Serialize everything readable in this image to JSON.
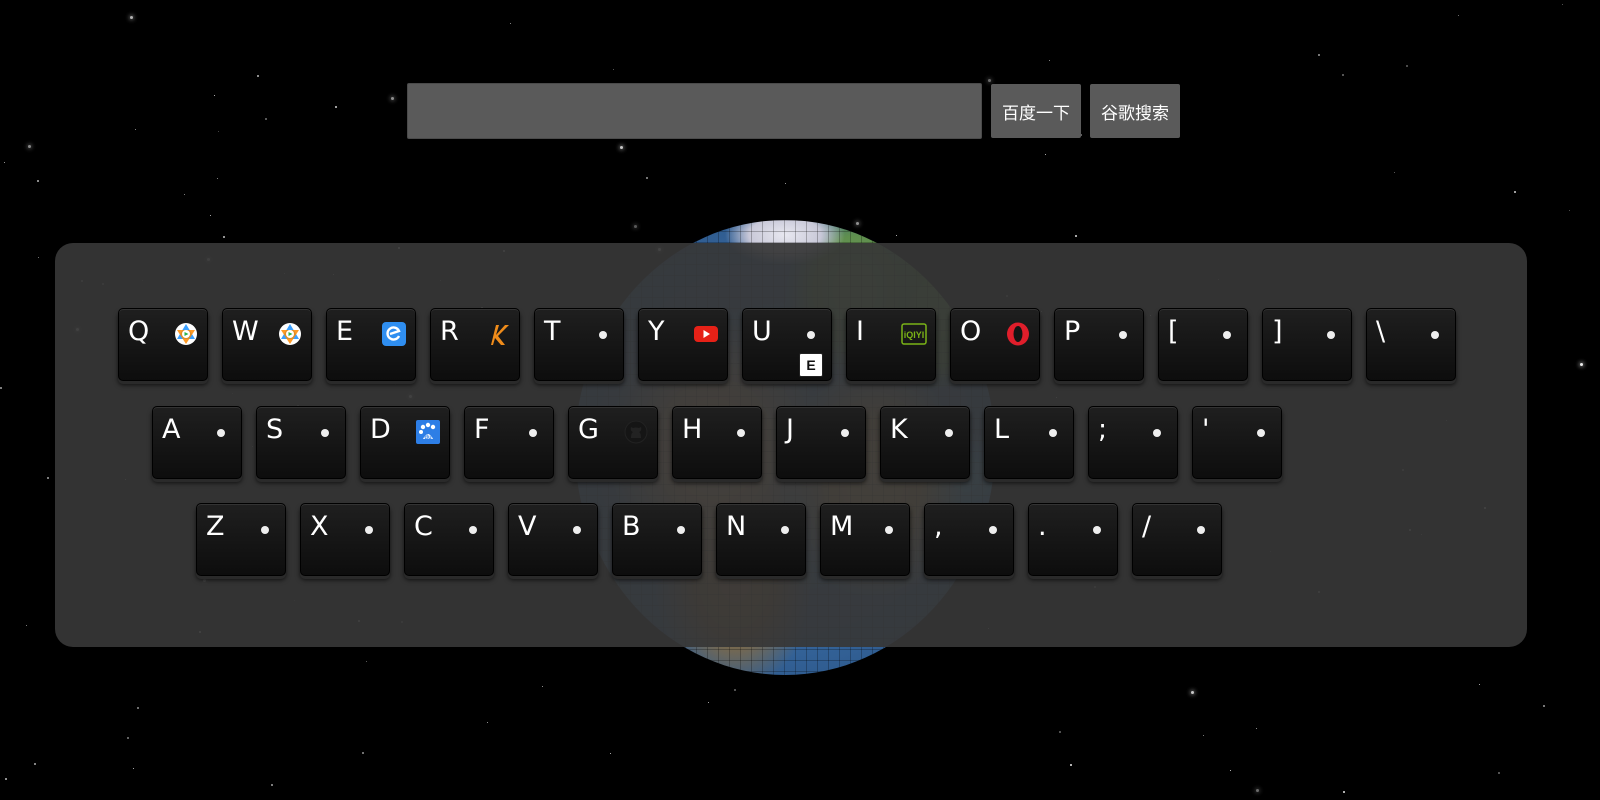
{
  "search": {
    "placeholder": "",
    "value": "",
    "baidu_label": "百度一下",
    "google_label": "谷歌搜索"
  },
  "keyboard": {
    "rows": [
      [
        {
          "key": "Q",
          "icon": "tencent-video-icon"
        },
        {
          "key": "W",
          "icon": "tencent-video-icon"
        },
        {
          "key": "E",
          "icon": "blue-e-icon"
        },
        {
          "key": "R",
          "icon": "orange-k-icon"
        },
        {
          "key": "T",
          "icon": "dot"
        },
        {
          "key": "Y",
          "icon": "youtube-icon"
        },
        {
          "key": "U",
          "icon": "dot",
          "badge": "E"
        },
        {
          "key": "I",
          "icon": "iqiyi-icon"
        },
        {
          "key": "O",
          "icon": "opera-icon"
        },
        {
          "key": "P",
          "icon": "dot"
        },
        {
          "key": "[",
          "icon": "dot"
        },
        {
          "key": "]",
          "icon": "dot"
        },
        {
          "key": "\\",
          "icon": "dot"
        }
      ],
      [
        {
          "key": "A",
          "icon": "dot"
        },
        {
          "key": "S",
          "icon": "dot"
        },
        {
          "key": "D",
          "icon": "baidu-icon"
        },
        {
          "key": "F",
          "icon": "dot"
        },
        {
          "key": "G",
          "icon": "github-icon"
        },
        {
          "key": "H",
          "icon": "dot"
        },
        {
          "key": "J",
          "icon": "dot"
        },
        {
          "key": "K",
          "icon": "dot"
        },
        {
          "key": "L",
          "icon": "dot"
        },
        {
          "key": ";",
          "icon": "dot"
        },
        {
          "key": "'",
          "icon": "dot"
        }
      ],
      [
        {
          "key": "Z",
          "icon": "dot"
        },
        {
          "key": "X",
          "icon": "dot"
        },
        {
          "key": "C",
          "icon": "dot"
        },
        {
          "key": "V",
          "icon": "dot"
        },
        {
          "key": "B",
          "icon": "dot"
        },
        {
          "key": "N",
          "icon": "dot"
        },
        {
          "key": "M",
          "icon": "dot"
        },
        {
          "key": ",",
          "icon": "dot"
        },
        {
          "key": ".",
          "icon": "dot"
        },
        {
          "key": "/",
          "icon": "dot"
        }
      ]
    ]
  },
  "colors": {
    "background": "#000000",
    "keyboard_panel": "#373737",
    "key": "#141414",
    "search_bg": "#5a5a5a"
  }
}
